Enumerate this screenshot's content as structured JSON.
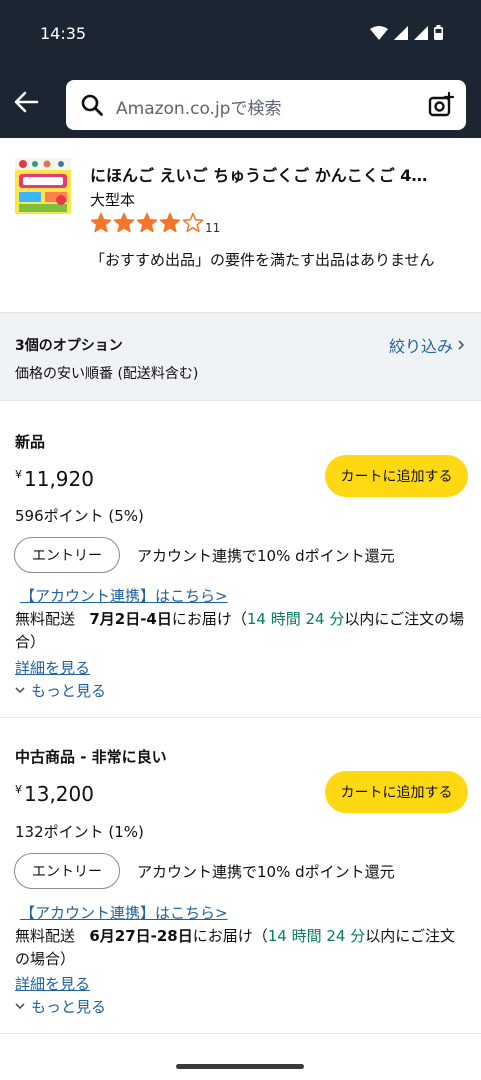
{
  "status": {
    "time": "14:35"
  },
  "search": {
    "placeholder": "Amazon.co.jpで検索"
  },
  "product": {
    "title": "にほんご えいご ちゅうごくご かんこくご 4…",
    "binding": "大型本",
    "rating": 4,
    "rating_max": 5,
    "review_count": "11",
    "note": "「おすすめ出品」の要件を満たす出品はありません"
  },
  "options": {
    "count_label": "3個のオプション",
    "sort_label": "価格の安い順番 (配送料含む)",
    "filter_label": "絞り込み"
  },
  "offers": [
    {
      "condition": "新品",
      "currency": "¥",
      "price": "11,920",
      "points": "596ポイント (5%)",
      "cart_label": "カートに追加する",
      "entry_label": "エントリー",
      "entry_text": "アカウント連携で10% dポイント還元",
      "connect_link": "【アカウント連携】はこちら>",
      "delivery_prefix": "無料配送",
      "delivery_date": "7月2日-4日",
      "delivery_mid": "にお届け（",
      "delivery_window": "14 時間 24 分",
      "delivery_suffix": "以内にご注文の場合）",
      "details_link": "詳細を見る",
      "see_more": "もっと見る"
    },
    {
      "condition": "中古商品 - 非常に良い",
      "currency": "¥",
      "price": "13,200",
      "points": "132ポイント (1%)",
      "cart_label": "カートに追加する",
      "entry_label": "エントリー",
      "entry_text": "アカウント連携で10% dポイント還元",
      "connect_link": "【アカウント連携】はこちら>",
      "delivery_prefix": "無料配送",
      "delivery_date": "6月27日-28日",
      "delivery_mid": "にお届け（",
      "delivery_window": "14 時間 24 分",
      "delivery_suffix": "以内にご注文の場合）",
      "details_link": "詳細を見る",
      "see_more": "もっと見る"
    }
  ],
  "colors": {
    "header_bg": "#1c2532",
    "cart_button": "#ffd814",
    "link": "#2162a1",
    "star": "#f3762b",
    "delivery_window": "#067d62"
  }
}
